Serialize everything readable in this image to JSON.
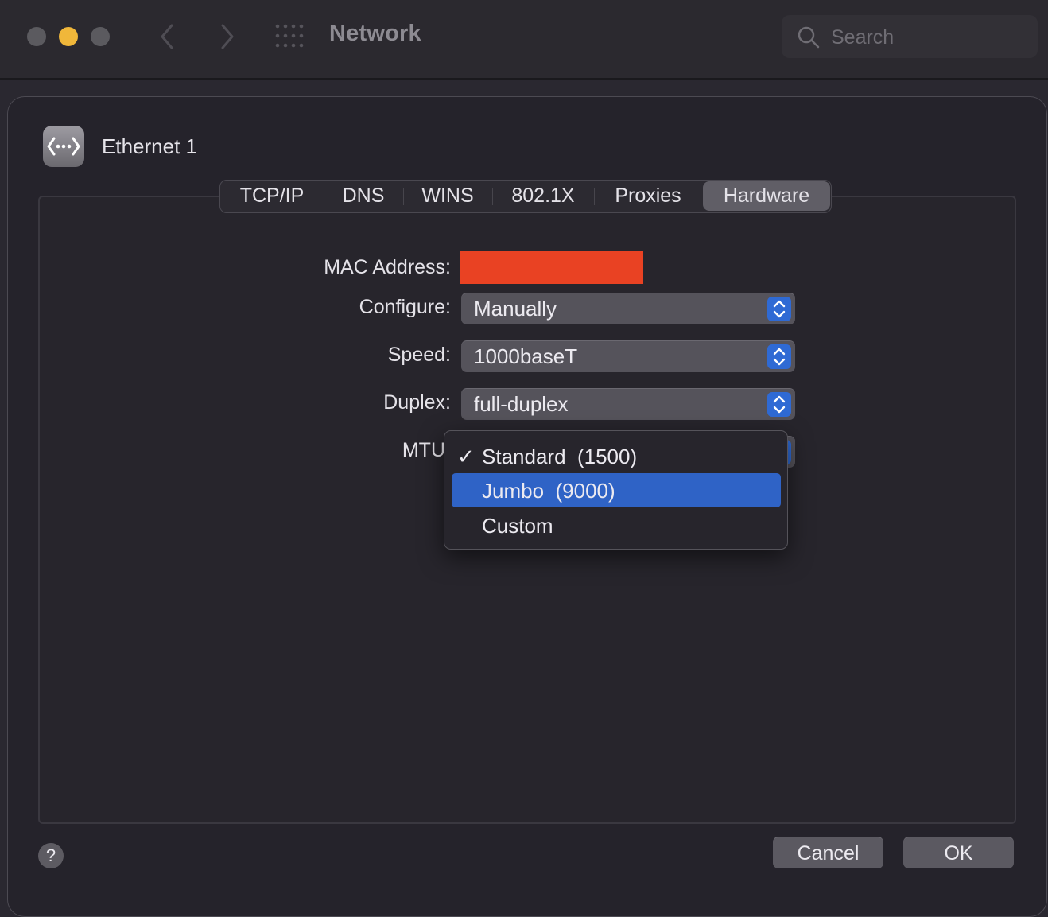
{
  "window": {
    "title": "Network"
  },
  "search": {
    "placeholder": "Search",
    "icon": "search-icon"
  },
  "service": {
    "name": "Ethernet 1",
    "icon": "ethernet-icon"
  },
  "tabs": [
    {
      "label": "TCP/IP",
      "active": false
    },
    {
      "label": "DNS",
      "active": false
    },
    {
      "label": "WINS",
      "active": false
    },
    {
      "label": "802.1X",
      "active": false
    },
    {
      "label": "Proxies",
      "active": false
    },
    {
      "label": "Hardware",
      "active": true
    }
  ],
  "form": {
    "mac_label": "MAC Address:",
    "configure_label": "Configure:",
    "configure_value": "Manually",
    "speed_label": "Speed:",
    "speed_value": "1000baseT",
    "duplex_label": "Duplex:",
    "duplex_value": "full-duplex",
    "mtu_label": "MTU"
  },
  "mtu_menu": {
    "items": [
      {
        "label": "Standard  (1500)",
        "checked": true,
        "highlighted": false
      },
      {
        "label": "Jumbo  (9000)",
        "checked": false,
        "highlighted": true
      },
      {
        "label": "Custom",
        "checked": false,
        "highlighted": false
      }
    ],
    "check_glyph": "✓"
  },
  "footer": {
    "help": "?",
    "cancel": "Cancel",
    "ok": "OK"
  },
  "colors": {
    "accent": "#2f63c6",
    "redaction": "#e94223",
    "traffic_minimize": "#f0b73a"
  }
}
